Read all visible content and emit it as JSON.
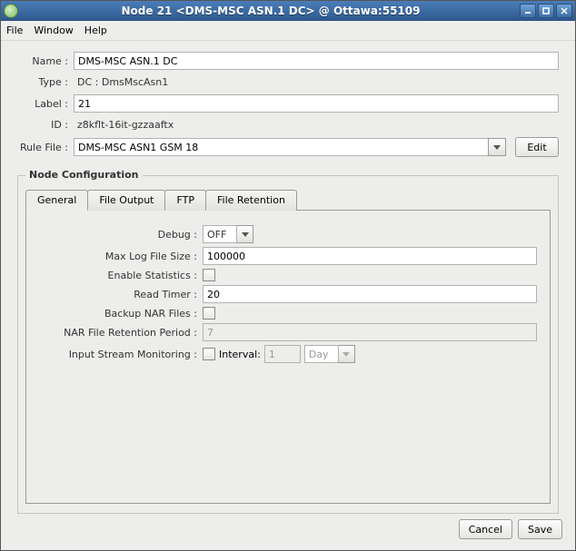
{
  "window": {
    "title": "Node 21 <DMS-MSC ASN.1 DC> @ Ottawa:55109"
  },
  "menu": {
    "file": "File",
    "window": "Window",
    "help": "Help"
  },
  "form": {
    "name_label": "Name :",
    "name_value": "DMS-MSC ASN.1 DC",
    "type_label": "Type :",
    "type_value": "DC : DmsMscAsn1",
    "label_label": "Label :",
    "label_value": "21",
    "id_label": "ID :",
    "id_value": "z8kflt-16it-gzzaaftx",
    "rulefile_label": "Rule File :",
    "rulefile_value": "DMS-MSC ASN1 GSM 18",
    "edit_btn": "Edit"
  },
  "node_config": {
    "legend": "Node Configuration",
    "tabs": {
      "general": "General",
      "file_output": "File Output",
      "ftp": "FTP",
      "file_retention": "File Retention"
    },
    "general": {
      "debug_label": "Debug :",
      "debug_value": "OFF",
      "maxlog_label": "Max Log File Size :",
      "maxlog_value": "100000",
      "stats_label": "Enable Statistics :",
      "stats_checked": false,
      "readtimer_label": "Read Timer :",
      "readtimer_value": "20",
      "backup_label": "Backup NAR Files :",
      "backup_checked": false,
      "retention_label": "NAR File Retention Period :",
      "retention_value": "7",
      "monitoring_label": "Input Stream Monitoring :",
      "monitoring_checked": false,
      "monitoring_interval_label": "Interval:",
      "monitoring_interval_value": "1",
      "monitoring_unit": "Day"
    }
  },
  "footer": {
    "cancel": "Cancel",
    "save": "Save"
  }
}
